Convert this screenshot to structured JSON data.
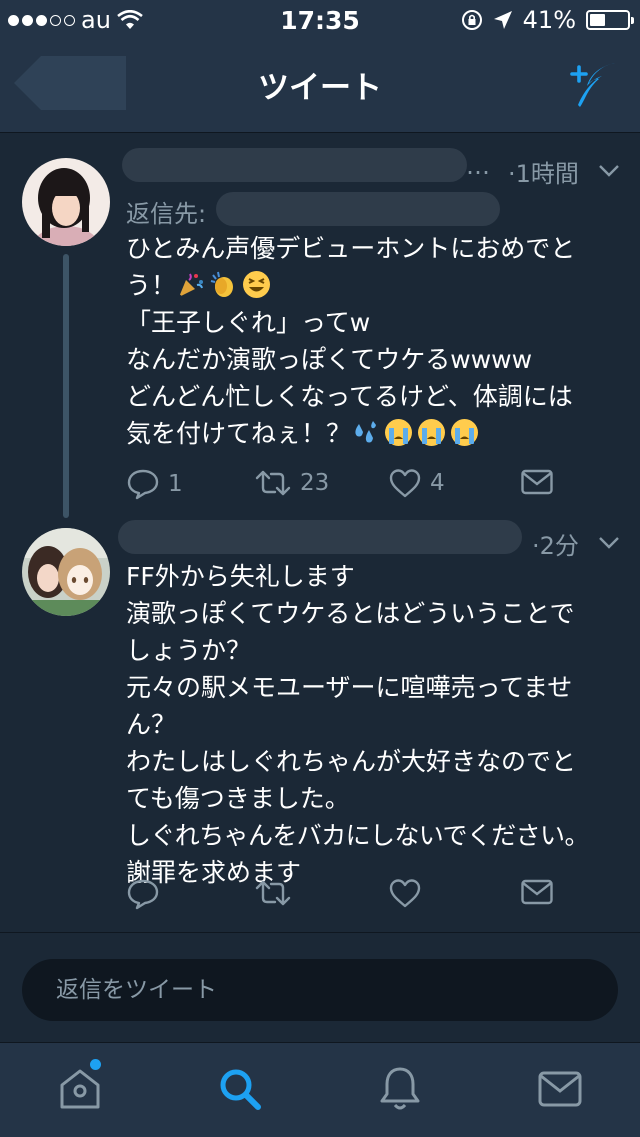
{
  "status_bar": {
    "carrier": "au",
    "time": "17:35",
    "battery": "41%",
    "battery_level": 0.41,
    "signal_bars_filled": 3,
    "signal_bars_total": 5
  },
  "nav": {
    "title": "ツイート"
  },
  "tweets": [
    {
      "time": "·1時間",
      "more": "…",
      "reply_to_label": "返信先:",
      "lines": [
        "ひとみん声優デビューホントにおめでと",
        "う！",
        "「王子しぐれ」ってw",
        "なんだか演歌っぽくてウケるwwww",
        "どんどん忙しくなってるけど、体調には",
        "気を付けてねぇ！？"
      ],
      "emojis_line2": [
        "party-popper-emoji",
        "clapping-hands-emoji",
        "grinning-squinting-face-emoji"
      ],
      "emojis_line6": [
        "sweat-droplets-emoji",
        "crying-face-emoji",
        "crying-face-emoji",
        "crying-face-emoji"
      ],
      "replies": "1",
      "retweets": "23",
      "likes": "4"
    },
    {
      "time": "·2分",
      "lines": [
        "FF外から失礼します",
        "演歌っぽくてウケるとはどういうことで",
        "しょうか？",
        "元々の駅メモユーザーに喧嘩売ってませ",
        "ん？",
        "わたしはしぐれちゃんが大好きなのでと",
        "ても傷つきました。",
        "しぐれちゃんをバカにしないでください。",
        "謝罪を求めます"
      ],
      "replies": "",
      "retweets": "",
      "likes": ""
    }
  ],
  "reply_box": {
    "placeholder": "返信をツイート"
  },
  "tabs": [
    "home-icon",
    "search-icon",
    "notifications-bell-icon",
    "messages-envelope-icon"
  ],
  "colors": {
    "background": "#1b2836",
    "bar": "#243447",
    "accent": "#1da1f2",
    "secondary_text": "#8899a6"
  }
}
